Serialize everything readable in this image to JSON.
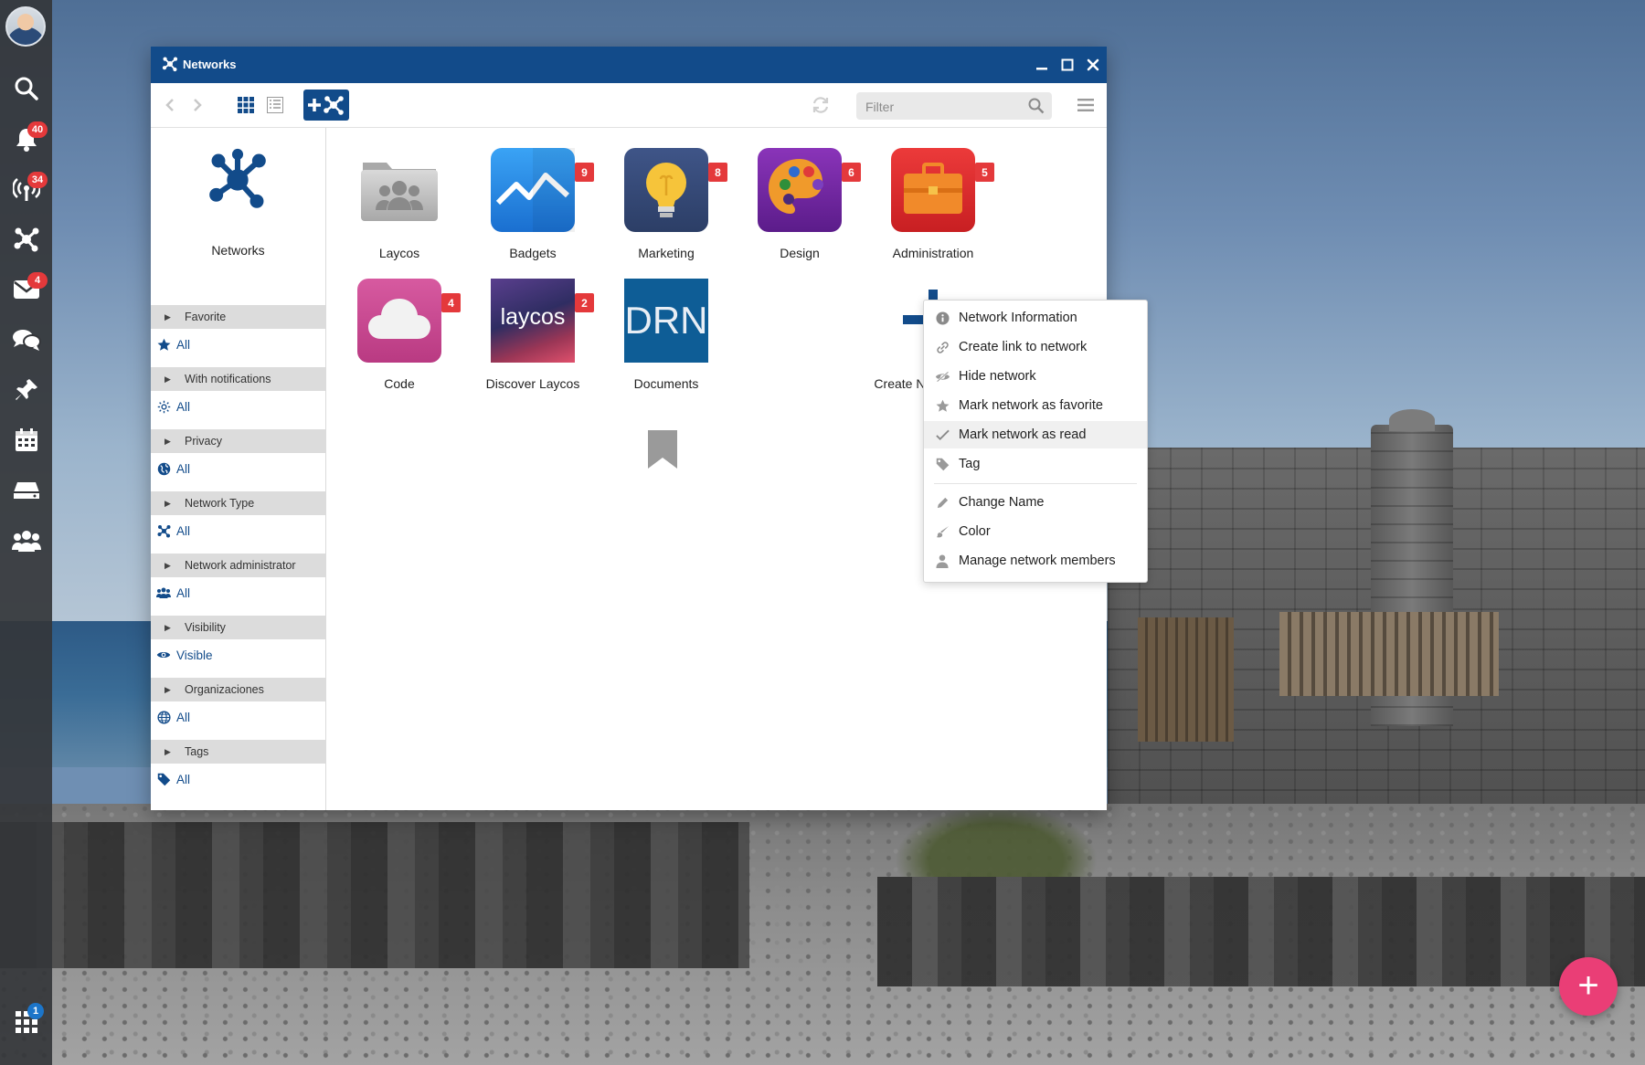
{
  "dock": {
    "badges": {
      "notifications": "40",
      "activity": "34",
      "mail": "4",
      "apps": "1"
    }
  },
  "window": {
    "title": "Networks",
    "filter_placeholder": "Filter"
  },
  "sidebar": {
    "header_label": "Networks",
    "sections": [
      {
        "title": "Favorite",
        "value": "All",
        "icon": "star-icon"
      },
      {
        "title": "With notifications",
        "value": "All",
        "icon": "sun-icon"
      },
      {
        "title": "Privacy",
        "value": "All",
        "icon": "globe-icon"
      },
      {
        "title": "Network Type",
        "value": "All",
        "icon": "network-icon"
      },
      {
        "title": "Network administrator",
        "value": "All",
        "icon": "users-icon"
      },
      {
        "title": "Visibility",
        "value": "Visible",
        "icon": "eye-icon"
      },
      {
        "title": "Organizaciones",
        "value": "All",
        "icon": "globe-icon"
      },
      {
        "title": "Tags",
        "value": "All",
        "icon": "tag-icon"
      }
    ]
  },
  "tiles": [
    {
      "name": "Laycos",
      "badge": ""
    },
    {
      "name": "Badgets",
      "badge": "9"
    },
    {
      "name": "Marketing",
      "badge": "8"
    },
    {
      "name": "Design",
      "badge": "6"
    },
    {
      "name": "Administration",
      "badge": "5"
    },
    {
      "name": "Code",
      "badge": "4"
    },
    {
      "name": "Discover Laycos",
      "badge": "2"
    },
    {
      "name": "Documents",
      "badge": ""
    },
    {
      "name": "Create New Network",
      "badge": ""
    }
  ],
  "tile_text": {
    "drn": "DRN",
    "laycos_logo": "laycos"
  },
  "context_menu": {
    "items": [
      "Network Information",
      "Create link to network",
      "Hide network",
      "Mark network as favorite",
      "Mark network as read",
      "Tag",
      "Change Name",
      "Color",
      "Manage network members"
    ]
  },
  "fab": {
    "label": "+"
  },
  "colors": {
    "titlebar": "#124b8a",
    "badge_red": "#e4393b",
    "fab_pink": "#ea3e76",
    "link_blue": "#124b8a"
  }
}
